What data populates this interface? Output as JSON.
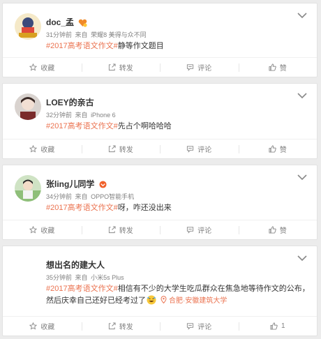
{
  "posts": [
    {
      "username": "doc_孟",
      "time": "31分钟前",
      "from_label": "来自",
      "source": "荣耀8 美得与众不同",
      "tag": "#2017高考语文作文#",
      "text": "静等作文题目",
      "location": "",
      "actions": {
        "collect": "收藏",
        "repost": "转发",
        "comment": "评论",
        "like": "赞"
      }
    },
    {
      "username": "LOEY的亲古",
      "time": "32分钟前",
      "from_label": "来自",
      "source": "iPhone 6",
      "tag": "#2017高考语文作文#",
      "text": "先占个啊哈哈哈",
      "location": "",
      "actions": {
        "collect": "收藏",
        "repost": "转发",
        "comment": "评论",
        "like": "赞"
      }
    },
    {
      "username": "张ling儿同学",
      "time": "34分钟前",
      "from_label": "来自",
      "source": "OPPO智能手机",
      "tag": "#2017高考语文作文#",
      "text": "呀，咋还没出来",
      "location": "",
      "actions": {
        "collect": "收藏",
        "repost": "转发",
        "comment": "评论",
        "like": "赞"
      }
    },
    {
      "username": "想出名的建大人",
      "time": "35分钟前",
      "from_label": "来自",
      "source": "小米5s Plus",
      "tag": "#2017高考语文作文#",
      "text": "相信有不少的大学生吃瓜群众在焦急地等待作文的公布，然后庆幸自己还好已经考过了",
      "location": "合肥·安徽建筑大学",
      "actions": {
        "collect": "收藏",
        "repost": "转发",
        "comment": "评论",
        "like": "1"
      }
    }
  ],
  "colors": {
    "accent": "#eb7350",
    "meta": "#808080",
    "background": "#ececec"
  }
}
